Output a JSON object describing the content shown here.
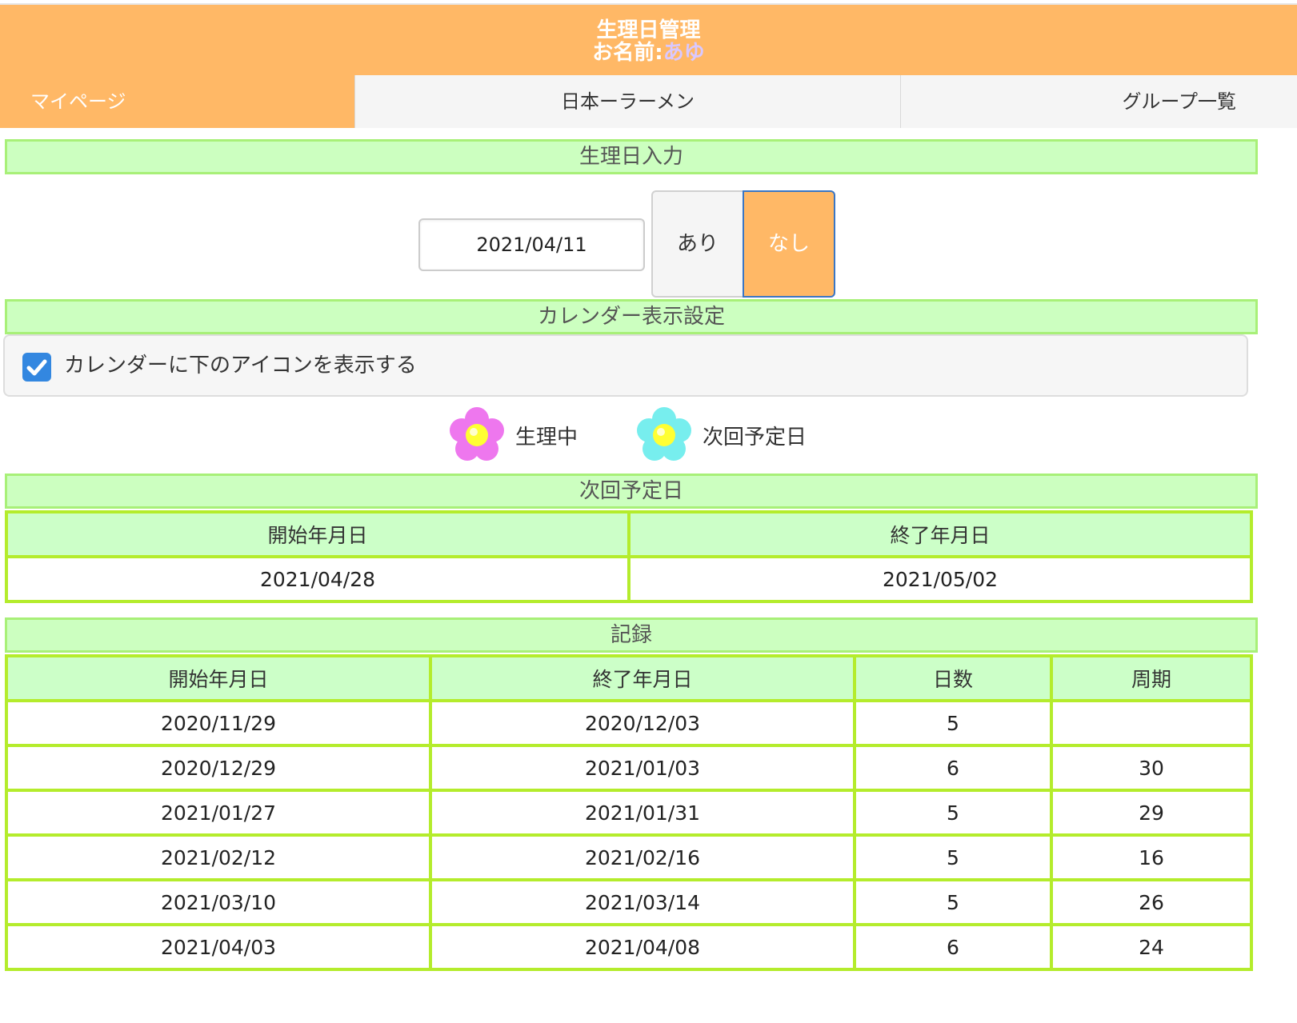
{
  "header": {
    "title": "生理日管理",
    "name_prefix": "お名前:",
    "user_name": "あゆ"
  },
  "nav": {
    "items": [
      {
        "label": "マイページ"
      },
      {
        "label": "日本ーラーメン"
      },
      {
        "label": "グループ一覧"
      }
    ]
  },
  "sections": {
    "input": "生理日入力",
    "calendar": "カレンダー表示設定",
    "next": "次回予定日",
    "record": "記録"
  },
  "input": {
    "date": "2021/04/11",
    "option_yes": "あり",
    "option_no": "なし",
    "selected": "なし"
  },
  "calendar": {
    "checkbox_label": "カレンダーに下のアイコンを表示する",
    "checked": true
  },
  "legend": [
    {
      "label": "生理中",
      "color": "#ee77ee"
    },
    {
      "label": "次回予定日",
      "color": "#77eeee"
    }
  ],
  "next_table": {
    "headers": [
      "開始年月日",
      "終了年月日"
    ],
    "row": [
      "2021/04/28",
      "2021/05/02"
    ]
  },
  "record_table": {
    "headers": [
      "開始年月日",
      "終了年月日",
      "日数",
      "周期"
    ],
    "rows": [
      [
        "2020/11/29",
        "2020/12/03",
        "5",
        ""
      ],
      [
        "2020/12/29",
        "2021/01/03",
        "6",
        "30"
      ],
      [
        "2021/01/27",
        "2021/01/31",
        "5",
        "29"
      ],
      [
        "2021/02/12",
        "2021/02/16",
        "5",
        "16"
      ],
      [
        "2021/03/10",
        "2021/03/14",
        "5",
        "26"
      ],
      [
        "2021/04/03",
        "2021/04/08",
        "6",
        "24"
      ]
    ]
  },
  "colors": {
    "accent": "#ffb866",
    "section_bg": "#ccffc0",
    "table_border": "#b4ec2c",
    "checkbox": "#3387e0"
  }
}
